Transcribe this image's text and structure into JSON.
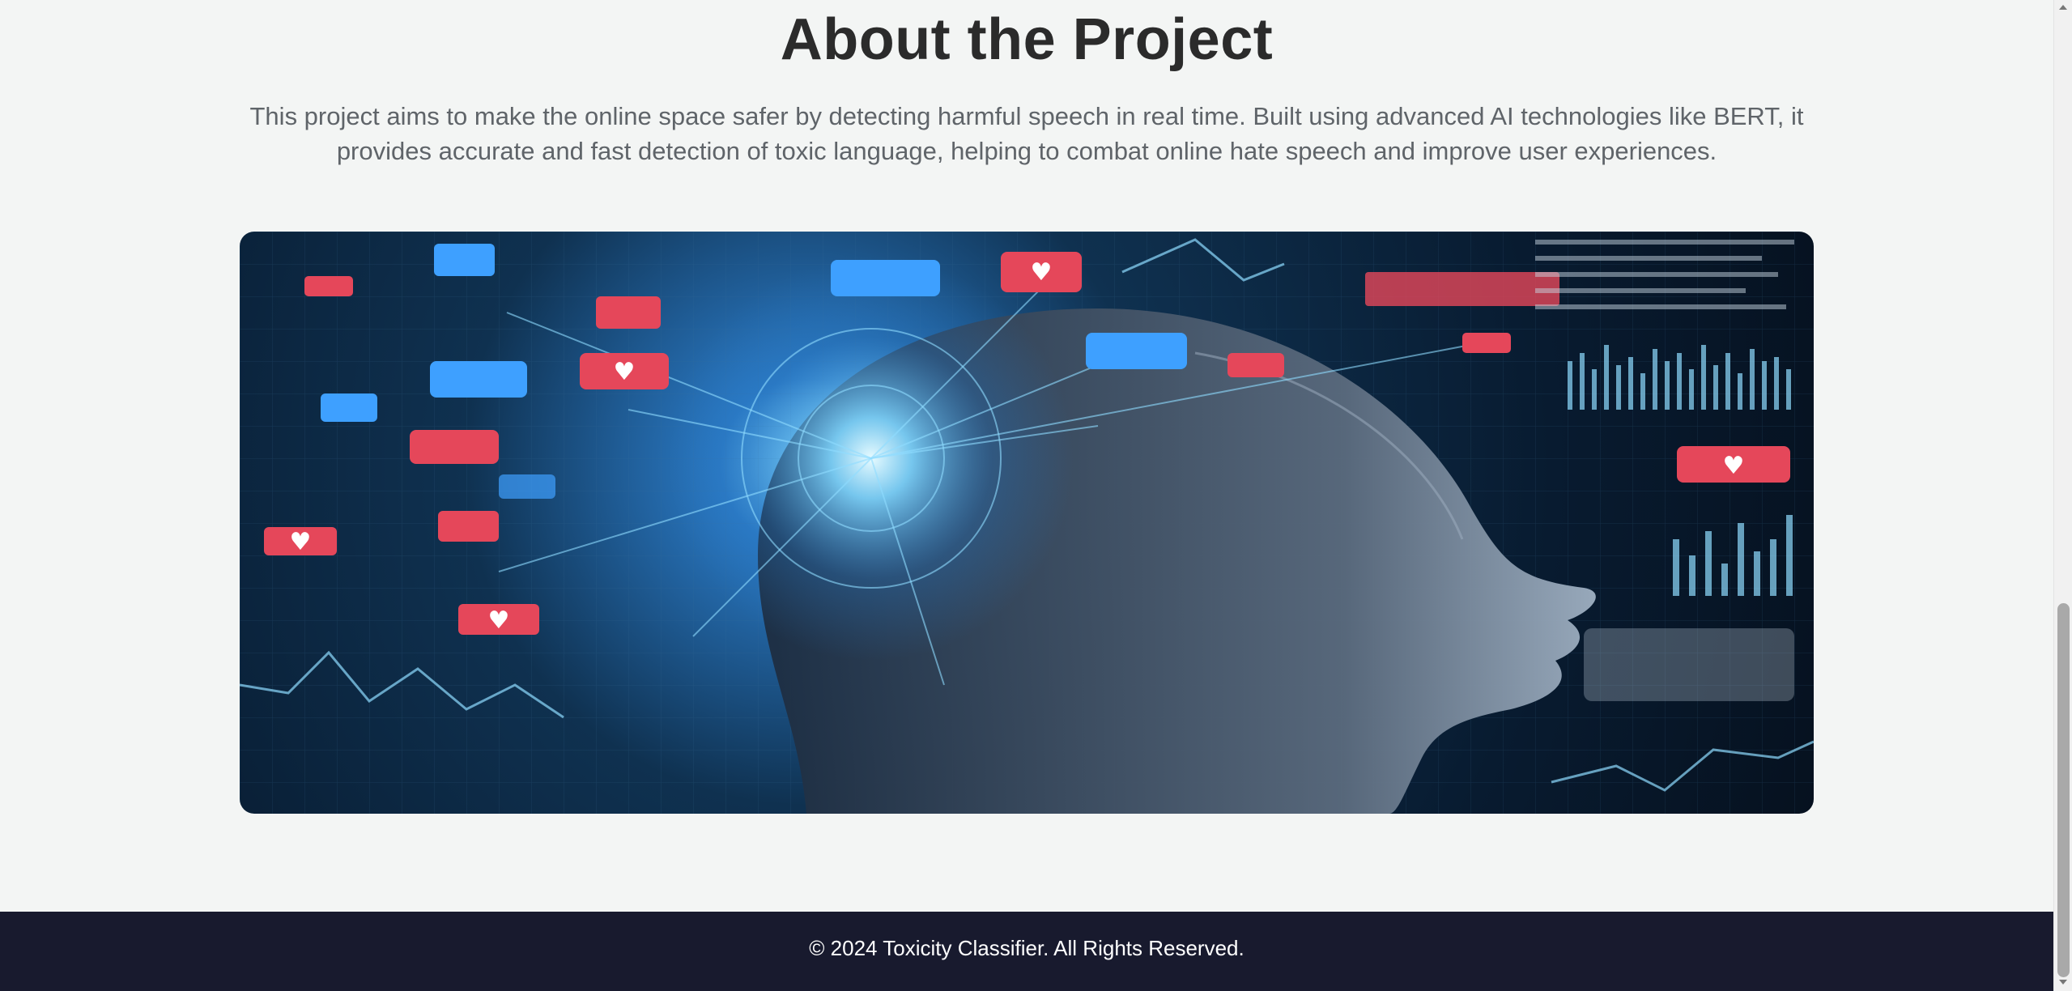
{
  "about": {
    "title": "About the Project",
    "description": "This project aims to make the online space safer by detecting harmful speech in real time. Built using advanced AI technologies like BERT, it provides accurate and fast detection of toxic language, helping to combat online hate speech and improve user experiences."
  },
  "hero_image": {
    "alt": "AI head with social media icons"
  },
  "footer": {
    "copyright": "© 2024 Toxicity Classifier. All Rights Reserved."
  },
  "colors": {
    "page_bg": "#f3f5f4",
    "footer_bg": "#181a2e",
    "title": "#2b2b2b",
    "text": "#5f6469",
    "accent_red": "#e5475a",
    "accent_blue": "#3ea0ff"
  }
}
